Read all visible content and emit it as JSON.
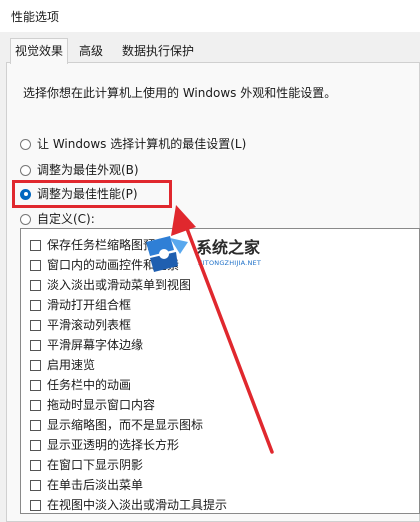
{
  "window": {
    "title": "性能选项"
  },
  "tabs": [
    {
      "label": "视觉效果"
    },
    {
      "label": "高级"
    },
    {
      "label": "数据执行保护"
    }
  ],
  "description": "选择你想在此计算机上使用的 Windows 外观和性能设置。",
  "radio_options": [
    {
      "label": "让 Windows 选择计算机的最佳设置(L)",
      "checked": false
    },
    {
      "label": "调整为最佳外观(B)",
      "checked": false
    },
    {
      "label": "调整为最佳性能(P)",
      "checked": true
    },
    {
      "label": "自定义(C):",
      "checked": false
    }
  ],
  "checkbox_items": [
    {
      "label": "保存任务栏缩略图预览",
      "checked": false
    },
    {
      "label": "窗口内的动画控件和元素",
      "checked": false
    },
    {
      "label": "淡入淡出或滑动菜单到视图",
      "checked": false
    },
    {
      "label": "滑动打开组合框",
      "checked": false
    },
    {
      "label": "平滑滚动列表框",
      "checked": false
    },
    {
      "label": "平滑屏幕字体边缘",
      "checked": false
    },
    {
      "label": "启用速览",
      "checked": false
    },
    {
      "label": "任务栏中的动画",
      "checked": false
    },
    {
      "label": "拖动时显示窗口内容",
      "checked": false
    },
    {
      "label": "显示缩略图，而不是显示图标",
      "checked": false
    },
    {
      "label": "显示亚透明的选择长方形",
      "checked": false
    },
    {
      "label": "在窗口下显示阴影",
      "checked": false
    },
    {
      "label": "在单击后淡出菜单",
      "checked": false
    },
    {
      "label": "在视图中淡入淡出或滑动工具提示",
      "checked": false
    }
  ],
  "watermark": {
    "text": "系统之家",
    "subtext": "XITONGZHIJIA.NET"
  },
  "annotation_color": "#e0282e"
}
